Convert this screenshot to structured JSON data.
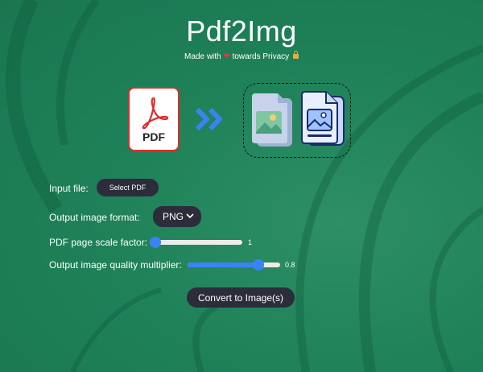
{
  "app": {
    "title": "Pdf2Img",
    "subtitle_prefix": "Made with",
    "subtitle_suffix": "towards Privacy"
  },
  "illustration": {
    "pdf_badge": "PDF",
    "source_icon": "pdf-file-icon",
    "arrow_icon": "double-chevron-right-icon",
    "output_icons": [
      "image-file-icon",
      "image-files-stack-icon"
    ]
  },
  "form": {
    "input_file_label": "Input file:",
    "select_pdf_label": "Select PDF",
    "output_format_label": "Output image format:",
    "output_format_value": "PNG",
    "scale_label": "PDF page scale factor:",
    "scale_value": "1",
    "scale_fraction": 0.0,
    "quality_label": "Output image quality multiplier:",
    "quality_value": "0.8",
    "quality_fraction": 0.8,
    "convert_label": "Convert to Image(s)"
  },
  "colors": {
    "background": "#1f8259",
    "accent": "#3b82f6",
    "button_dark": "#2c2c3a",
    "pdf_red": "#e02b2b"
  }
}
